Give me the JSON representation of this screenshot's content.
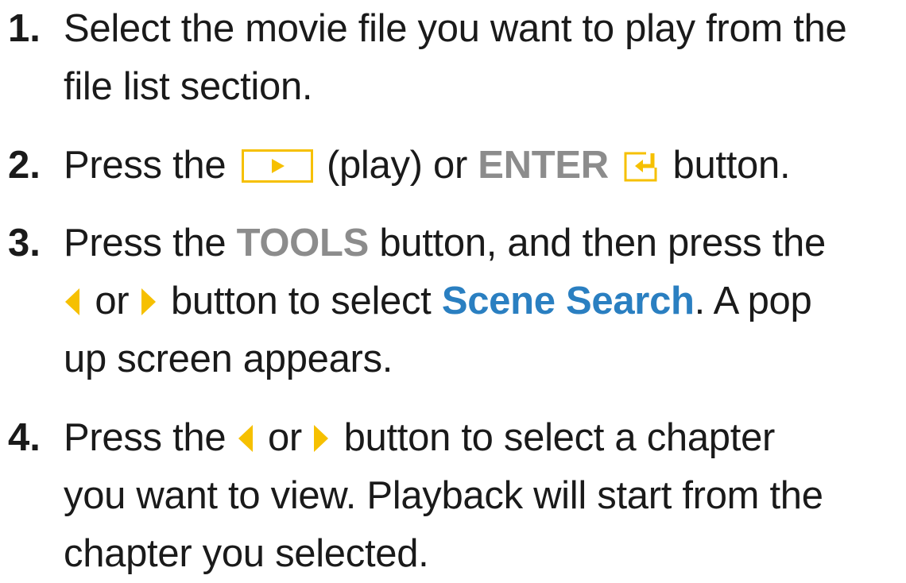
{
  "steps": [
    {
      "number": "1.",
      "lines": [
        "Select the movie file you want to play from the",
        "file list section."
      ]
    },
    {
      "number": "2.",
      "t1": "Press the",
      "t2": "(play) or",
      "enter": "ENTER",
      "t3": "button."
    },
    {
      "number": "3.",
      "l1a": "Press the",
      "tools": "TOOLS",
      "l1b": "button, and then press the",
      "l2a": "or",
      "l2b": "button to select",
      "scene_search": "Scene Search",
      "l2c": ". A pop",
      "l3": "up screen appears."
    },
    {
      "number": "4.",
      "l1a": "Press the",
      "l1b": "or",
      "l1c": "button to select a chapter",
      "l2": "you want to view. Playback will start from the",
      "l3": "chapter you selected."
    }
  ],
  "icons": {
    "play": "play-icon",
    "enter": "enter-icon",
    "left": "left-arrow-icon",
    "right": "right-arrow-icon"
  },
  "colors": {
    "text": "#1a1a1a",
    "keyword_gray": "#8c8c8c",
    "keyword_blue": "#2a7fc1",
    "icon_yellow": "#f6c000"
  }
}
